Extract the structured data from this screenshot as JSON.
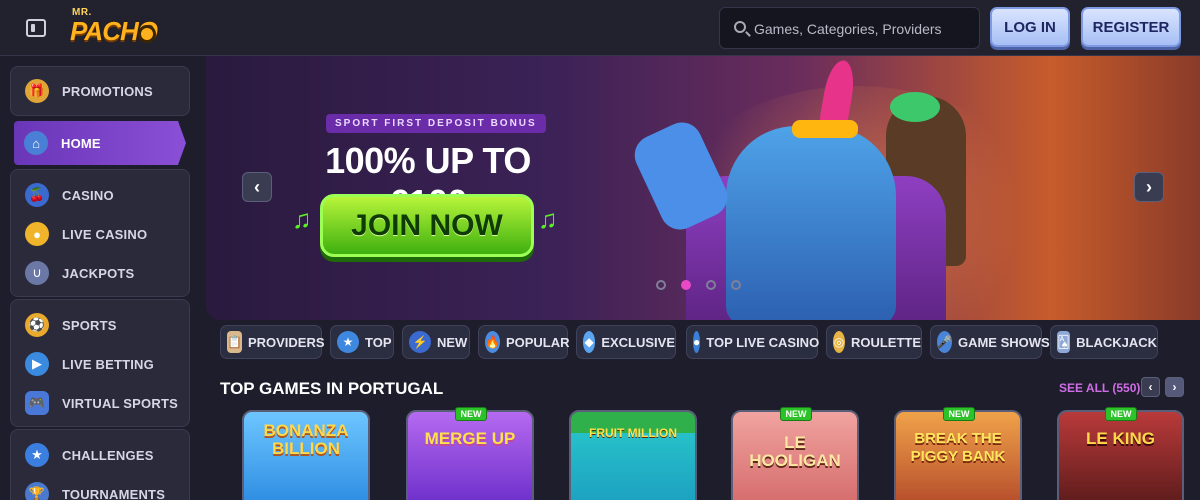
{
  "header": {
    "logo_small": "MR.",
    "logo_main": "PACHO",
    "search_placeholder": "Games, Categories, Providers",
    "login_label": "LOG IN",
    "register_label": "REGISTER"
  },
  "sidebar": {
    "groups": [
      {
        "items": [
          {
            "label": "PROMOTIONS",
            "icon": "gift-icon"
          }
        ]
      },
      {
        "items": [
          {
            "label": "HOME",
            "icon": "home-icon",
            "active": true
          }
        ]
      },
      {
        "items": [
          {
            "label": "CASINO",
            "icon": "cherries-icon"
          },
          {
            "label": "LIVE CASINO",
            "icon": "roulette-chip-icon"
          },
          {
            "label": "JACKPOTS",
            "icon": "horseshoe-icon"
          }
        ]
      },
      {
        "items": [
          {
            "label": "SPORTS",
            "icon": "football-icon"
          },
          {
            "label": "LIVE BETTING",
            "icon": "play-icon"
          },
          {
            "label": "VIRTUAL SPORTS",
            "icon": "gamepad-icon"
          }
        ]
      },
      {
        "items": [
          {
            "label": "CHALLENGES",
            "icon": "medal-icon"
          },
          {
            "label": "TOURNAMENTS",
            "icon": "trophy-icon"
          }
        ]
      }
    ]
  },
  "banner": {
    "badge": "SPORT FIRST DEPOSIT BONUS",
    "title": "100% UP TO €100",
    "cta": "JOIN NOW",
    "prev": "‹",
    "next": "›",
    "slides": 4,
    "active_slide": 2
  },
  "categories": [
    {
      "label": "PROVIDERS",
      "icon": "notepad-icon"
    },
    {
      "label": "TOP",
      "icon": "star-icon"
    },
    {
      "label": "NEW",
      "icon": "lightning-icon"
    },
    {
      "label": "POPULAR",
      "icon": "fire-icon"
    },
    {
      "label": "EXCLUSIVE",
      "icon": "diamond-icon"
    },
    {
      "label": "TOP LIVE CASINO",
      "icon": "chip-icon"
    },
    {
      "label": "ROULETTE",
      "icon": "roulette-icon"
    },
    {
      "label": "GAME SHOWS",
      "icon": "microphone-icon"
    },
    {
      "label": "BLACKJACK",
      "icon": "cards-icon"
    }
  ],
  "section": {
    "title": "TOP GAMES IN PORTUGAL",
    "see_all": "SEE ALL (550)",
    "prev": "‹",
    "next": "›"
  },
  "games": [
    {
      "title": "BONANZA BILLION",
      "new": false
    },
    {
      "title": "MERGE UP",
      "new": true
    },
    {
      "title": "FRUIT MILLION",
      "new": false
    },
    {
      "title": "LE HOOLIGAN",
      "new": true
    },
    {
      "title": "BREAK THE PIGGY BANK",
      "new": true
    },
    {
      "title": "LE KING",
      "new": true
    }
  ],
  "new_badge": "NEW",
  "colors": {
    "accent_purple": "#8a4fd6",
    "join_green": "#3fb00f",
    "see_all_pink": "#d06de6",
    "active_dot": "#e74ac4"
  }
}
